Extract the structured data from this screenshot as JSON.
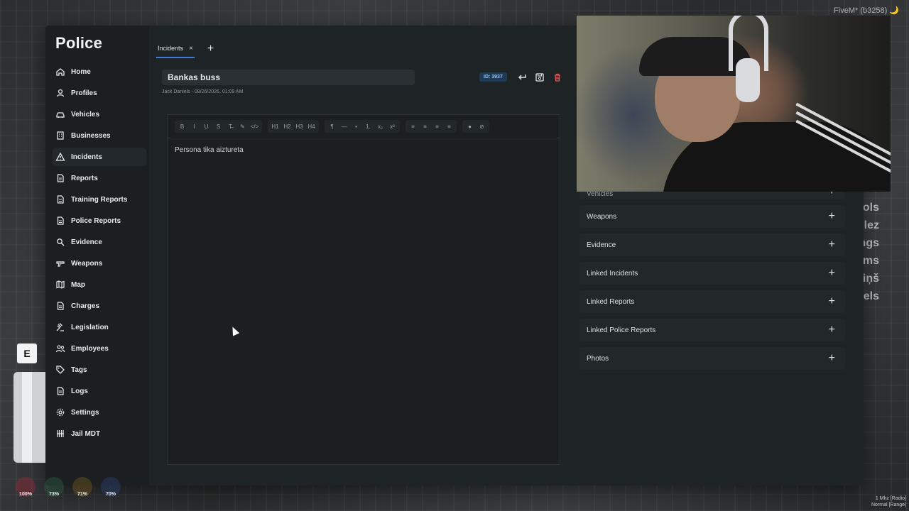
{
  "game": {
    "top_right_label": "FiveM* (b3258) 🌙",
    "side_words": [
      "ols",
      "lez",
      "ngs",
      "ms",
      "iņš",
      "els"
    ],
    "interact_key": "E",
    "stats": [
      "100%",
      "73%",
      "71%",
      "70%"
    ],
    "radio_line1": "1 Mhz [Radio]",
    "radio_line2": "Normal [Range]"
  },
  "app": {
    "title": "Police",
    "nav": [
      {
        "label": "Home",
        "icon": "home-icon"
      },
      {
        "label": "Profiles",
        "icon": "user-icon"
      },
      {
        "label": "Vehicles",
        "icon": "car-icon"
      },
      {
        "label": "Businesses",
        "icon": "building-icon"
      },
      {
        "label": "Incidents",
        "icon": "warning-icon"
      },
      {
        "label": "Reports",
        "icon": "file-icon"
      },
      {
        "label": "Training Reports",
        "icon": "file-icon"
      },
      {
        "label": "Police Reports",
        "icon": "file-icon"
      },
      {
        "label": "Evidence",
        "icon": "magnify-icon"
      },
      {
        "label": "Weapons",
        "icon": "gun-icon"
      },
      {
        "label": "Map",
        "icon": "map-icon"
      },
      {
        "label": "Charges",
        "icon": "file-icon"
      },
      {
        "label": "Legislation",
        "icon": "gavel-icon"
      },
      {
        "label": "Employees",
        "icon": "users-icon"
      },
      {
        "label": "Tags",
        "icon": "tag-icon"
      },
      {
        "label": "Logs",
        "icon": "file-icon"
      },
      {
        "label": "Settings",
        "icon": "gear-icon"
      },
      {
        "label": "Jail MDT",
        "icon": "bars-icon"
      }
    ],
    "active_nav": "Incidents"
  },
  "tabs": {
    "items": [
      {
        "label": "Incidents",
        "close": "×"
      }
    ],
    "add_label": "+"
  },
  "incident": {
    "title": "Bankas buss",
    "meta": "Jack Daniels - 08/26/2026, 01:09 AM",
    "id_badge": "ID: 3937",
    "body_text": "Persona tika aiztureta"
  },
  "editor_toolbar": {
    "groups": [
      [
        "B",
        "I",
        "U",
        "S",
        "T̶",
        "✎",
        "</>"
      ],
      [
        "H1",
        "H2",
        "H3",
        "H4"
      ],
      [
        "¶",
        "—",
        "•",
        "1.",
        "x₂",
        "x²"
      ],
      [
        "≡",
        "≡",
        "≡",
        "≡"
      ],
      [
        "●",
        "⊘"
      ]
    ]
  },
  "accordions": [
    {
      "label": "Vehicles",
      "partial": true
    },
    {
      "label": "Weapons"
    },
    {
      "label": "Evidence"
    },
    {
      "label": "Linked Incidents"
    },
    {
      "label": "Linked Reports"
    },
    {
      "label": "Linked Police Reports"
    },
    {
      "label": "Photos"
    }
  ],
  "accordion_add": "+"
}
